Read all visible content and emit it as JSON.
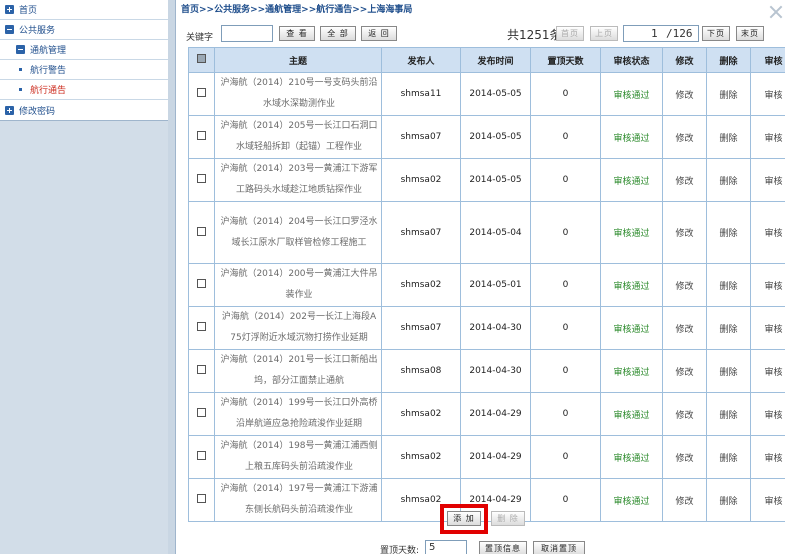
{
  "sidebar": {
    "items": [
      {
        "label": "首页"
      },
      {
        "label": "公共服务"
      },
      {
        "label": "通航管理"
      },
      {
        "label": "航行警告"
      },
      {
        "label": "航行通告"
      },
      {
        "label": "修改密码"
      }
    ]
  },
  "breadcrumb": "首页>>公共服务>>通航管理>>航行通告>>上海海事局",
  "toolbar": {
    "keyword_label": "关键字",
    "keyword_value": "",
    "search_label": "查 看",
    "all_label": "全 部",
    "back_label": "返 回",
    "total_text": "共1251条",
    "first_label": "首页",
    "prev_label": "上页",
    "current_page": "1",
    "total_pages": "/126",
    "next_label": "下页",
    "last_label": "末页"
  },
  "table": {
    "headers": [
      "",
      "主题",
      "发布人",
      "发布时间",
      "置顶天数",
      "审核状态",
      "修改",
      "删除",
      "审核"
    ],
    "rows": [
      {
        "subject": "沪海航（2014）210号一号支码头前沿水域水深勘测作业",
        "publisher": "shmsa11",
        "date": "2014-05-05",
        "days": "0",
        "status": "审核通过",
        "edit": "修改",
        "delete": "删除",
        "audit": "审核"
      },
      {
        "subject": "沪海航（2014）205号一长江口石洞口水域轻船拆卸（起锚）工程作业",
        "publisher": "shmsa07",
        "date": "2014-05-05",
        "days": "0",
        "status": "审核通过",
        "edit": "修改",
        "delete": "删除",
        "audit": "审核"
      },
      {
        "subject": "沪海航（2014）203号一黄浦江下游军工路码头水域趁江地质钻探作业",
        "publisher": "shmsa02",
        "date": "2014-05-05",
        "days": "0",
        "status": "审核通过",
        "edit": "修改",
        "delete": "删除",
        "audit": "审核"
      },
      {
        "subject": "沪海航（2014）204号一长江口罗泾水域长江原水厂取样管检修工程施工",
        "publisher": "shmsa07",
        "date": "2014-05-04",
        "days": "0",
        "status": "审核通过",
        "edit": "修改",
        "delete": "删除",
        "audit": "审核"
      },
      {
        "subject": "沪海航（2014）200号一黄浦江大件吊装作业",
        "publisher": "shmsa02",
        "date": "2014-05-01",
        "days": "0",
        "status": "审核通过",
        "edit": "修改",
        "delete": "删除",
        "audit": "审核"
      },
      {
        "subject": "沪海航（2014）202号一长江上海段A75灯浮附近水域沉物打捞作业延期",
        "publisher": "shmsa07",
        "date": "2014-04-30",
        "days": "0",
        "status": "审核通过",
        "edit": "修改",
        "delete": "删除",
        "audit": "审核"
      },
      {
        "subject": "沪海航（2014）201号一长江口新船出坞，部分江面禁止通航",
        "publisher": "shmsa08",
        "date": "2014-04-30",
        "days": "0",
        "status": "审核通过",
        "edit": "修改",
        "delete": "删除",
        "audit": "审核"
      },
      {
        "subject": "沪海航（2014）199号一长江口外高桥沿岸航道应急抢险疏浚作业延期",
        "publisher": "shmsa02",
        "date": "2014-04-29",
        "days": "0",
        "status": "审核通过",
        "edit": "修改",
        "delete": "删除",
        "audit": "审核"
      },
      {
        "subject": "沪海航（2014）198号一黄浦江浦西侧上粮五库码头前沿疏浚作业",
        "publisher": "shmsa02",
        "date": "2014-04-29",
        "days": "0",
        "status": "审核通过",
        "edit": "修改",
        "delete": "删除",
        "audit": "审核"
      },
      {
        "subject": "沪海航（2014）197号一黄浦江下游浦东侧长航码头前沿疏浚作业",
        "publisher": "shmsa02",
        "date": "2014-04-29",
        "days": "0",
        "status": "审核通过",
        "edit": "修改",
        "delete": "删除",
        "audit": "审核"
      }
    ]
  },
  "bottom": {
    "add_label": "添 加",
    "delete_label": "删 除",
    "top_days_label": "置顶天数:",
    "top_days_value": "5",
    "top_info_label": "置顶信息",
    "cancel_top_label": "取消置顶"
  },
  "colors": {
    "accent": "#1f4e8c",
    "active_menu": "#cc2a1c",
    "status_ok": "#2b8a2b",
    "highlight": "#e10000",
    "table_header": "#cfe0f2"
  }
}
